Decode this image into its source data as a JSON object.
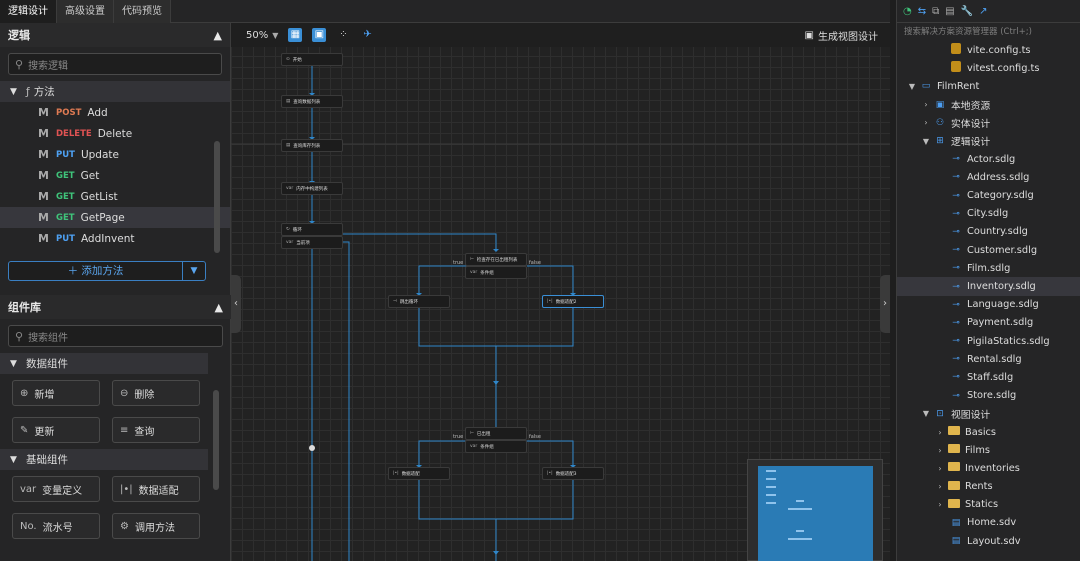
{
  "tabs": [
    "逻辑设计",
    "高级设置",
    "代码预览"
  ],
  "logic": {
    "title": "逻辑",
    "search_placeholder": "搜索逻辑",
    "group_label": "方法",
    "methods": [
      {
        "verb": "POST",
        "name": "Add"
      },
      {
        "verb": "DELETE",
        "name": "Delete"
      },
      {
        "verb": "PUT",
        "name": "Update"
      },
      {
        "verb": "GET",
        "name": "Get"
      },
      {
        "verb": "GET",
        "name": "GetList"
      },
      {
        "verb": "GET",
        "name": "GetPage"
      },
      {
        "verb": "PUT",
        "name": "AddInvent"
      }
    ],
    "add_method_label": "添加方法"
  },
  "components": {
    "title": "组件库",
    "search_placeholder": "搜索组件",
    "data_group": "数据组件",
    "data_items": [
      "新增",
      "删除",
      "更新",
      "查询"
    ],
    "basic_group": "基础组件",
    "basic_items": [
      {
        "icon": "var",
        "label": "变量定义"
      },
      {
        "icon": "|•|",
        "label": "数据适配"
      },
      {
        "icon": "No.",
        "label": "流水号"
      },
      {
        "icon": "⚙",
        "label": "调用方法"
      }
    ]
  },
  "canvas": {
    "zoom": "50%",
    "generate_view_label": "生成视图设计",
    "nodes": [
      "开始",
      "查询数据列表",
      "查询库存列表",
      "内存中构建列表",
      "循环",
      "当前项",
      "检查存在已出租列表",
      "条件组",
      "跳出循环",
      "数据适配2",
      "已出租",
      "条件组",
      "数据适配",
      "数据适配3"
    ],
    "true_label": "true",
    "false_label": "false"
  },
  "solution": {
    "search_placeholder": "搜索解决方案资源管理器 (Ctrl+;)",
    "items": [
      {
        "label": "vite.config.ts",
        "type": "ts"
      },
      {
        "label": "vitest.config.ts",
        "type": "ts"
      },
      {
        "label": "FilmRent",
        "type": "project"
      },
      {
        "label": "本地资源",
        "type": "res"
      },
      {
        "label": "实体设计",
        "type": "entity"
      },
      {
        "label": "逻辑设计",
        "type": "logic"
      },
      {
        "label": "Actor.sdlg",
        "type": "sdlg"
      },
      {
        "label": "Address.sdlg",
        "type": "sdlg"
      },
      {
        "label": "Category.sdlg",
        "type": "sdlg"
      },
      {
        "label": "City.sdlg",
        "type": "sdlg"
      },
      {
        "label": "Country.sdlg",
        "type": "sdlg"
      },
      {
        "label": "Customer.sdlg",
        "type": "sdlg"
      },
      {
        "label": "Film.sdlg",
        "type": "sdlg"
      },
      {
        "label": "Inventory.sdlg",
        "type": "sdlg"
      },
      {
        "label": "Language.sdlg",
        "type": "sdlg"
      },
      {
        "label": "Payment.sdlg",
        "type": "sdlg"
      },
      {
        "label": "PigilaStatics.sdlg",
        "type": "sdlg"
      },
      {
        "label": "Rental.sdlg",
        "type": "sdlg"
      },
      {
        "label": "Staff.sdlg",
        "type": "sdlg"
      },
      {
        "label": "Store.sdlg",
        "type": "sdlg"
      },
      {
        "label": "视图设计",
        "type": "view"
      },
      {
        "label": "Basics",
        "type": "folder"
      },
      {
        "label": "Films",
        "type": "folder"
      },
      {
        "label": "Inventories",
        "type": "folder"
      },
      {
        "label": "Rents",
        "type": "folder"
      },
      {
        "label": "Statics",
        "type": "folder"
      },
      {
        "label": "Home.sdv",
        "type": "sdv"
      },
      {
        "label": "Layout.sdv",
        "type": "sdv"
      }
    ]
  },
  "colors": {
    "accent": "#3a8fd6",
    "post": "#e07b53",
    "delete": "#e05353",
    "put": "#4ea1f3",
    "get": "#3fc47a"
  }
}
